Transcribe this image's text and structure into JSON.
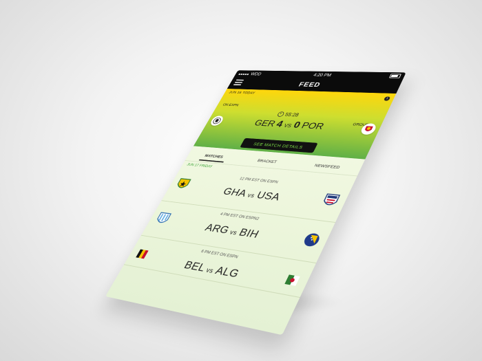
{
  "status_bar": {
    "carrier": "WDD",
    "time": "4:20 PM"
  },
  "nav": {
    "title": "FEED"
  },
  "hero": {
    "date": "JUN 16 TODAY",
    "channel": "ON ESPN",
    "group": "GROUP G",
    "timer": "55:28",
    "home_team": "GER",
    "home_score": "4",
    "vs": "VS",
    "away_score": "0",
    "away_team": "POR",
    "button_label": "SEE MATCH DETAILS"
  },
  "tabs": [
    {
      "label": "MATCHES"
    },
    {
      "label": "BRACKET"
    },
    {
      "label": "NEWSFEED"
    }
  ],
  "day_label": "JUN 17 FRIDAY",
  "matches": [
    {
      "time": "12 PM EST ON ESPN",
      "home": "GHA",
      "vs": "vs",
      "away": "USA"
    },
    {
      "time": "4 PM EST ON ESPN2",
      "home": "ARG",
      "vs": "vs",
      "away": "BIH"
    },
    {
      "time": "6 PM EST ON ESPN",
      "home": "BEL",
      "vs": "vs",
      "away": "ALG"
    }
  ],
  "colors": {
    "hero_top": "#ffd400",
    "hero_bottom": "#50a836",
    "accent_green": "#7ddf47",
    "bar_dark": "#0b0b0b"
  }
}
